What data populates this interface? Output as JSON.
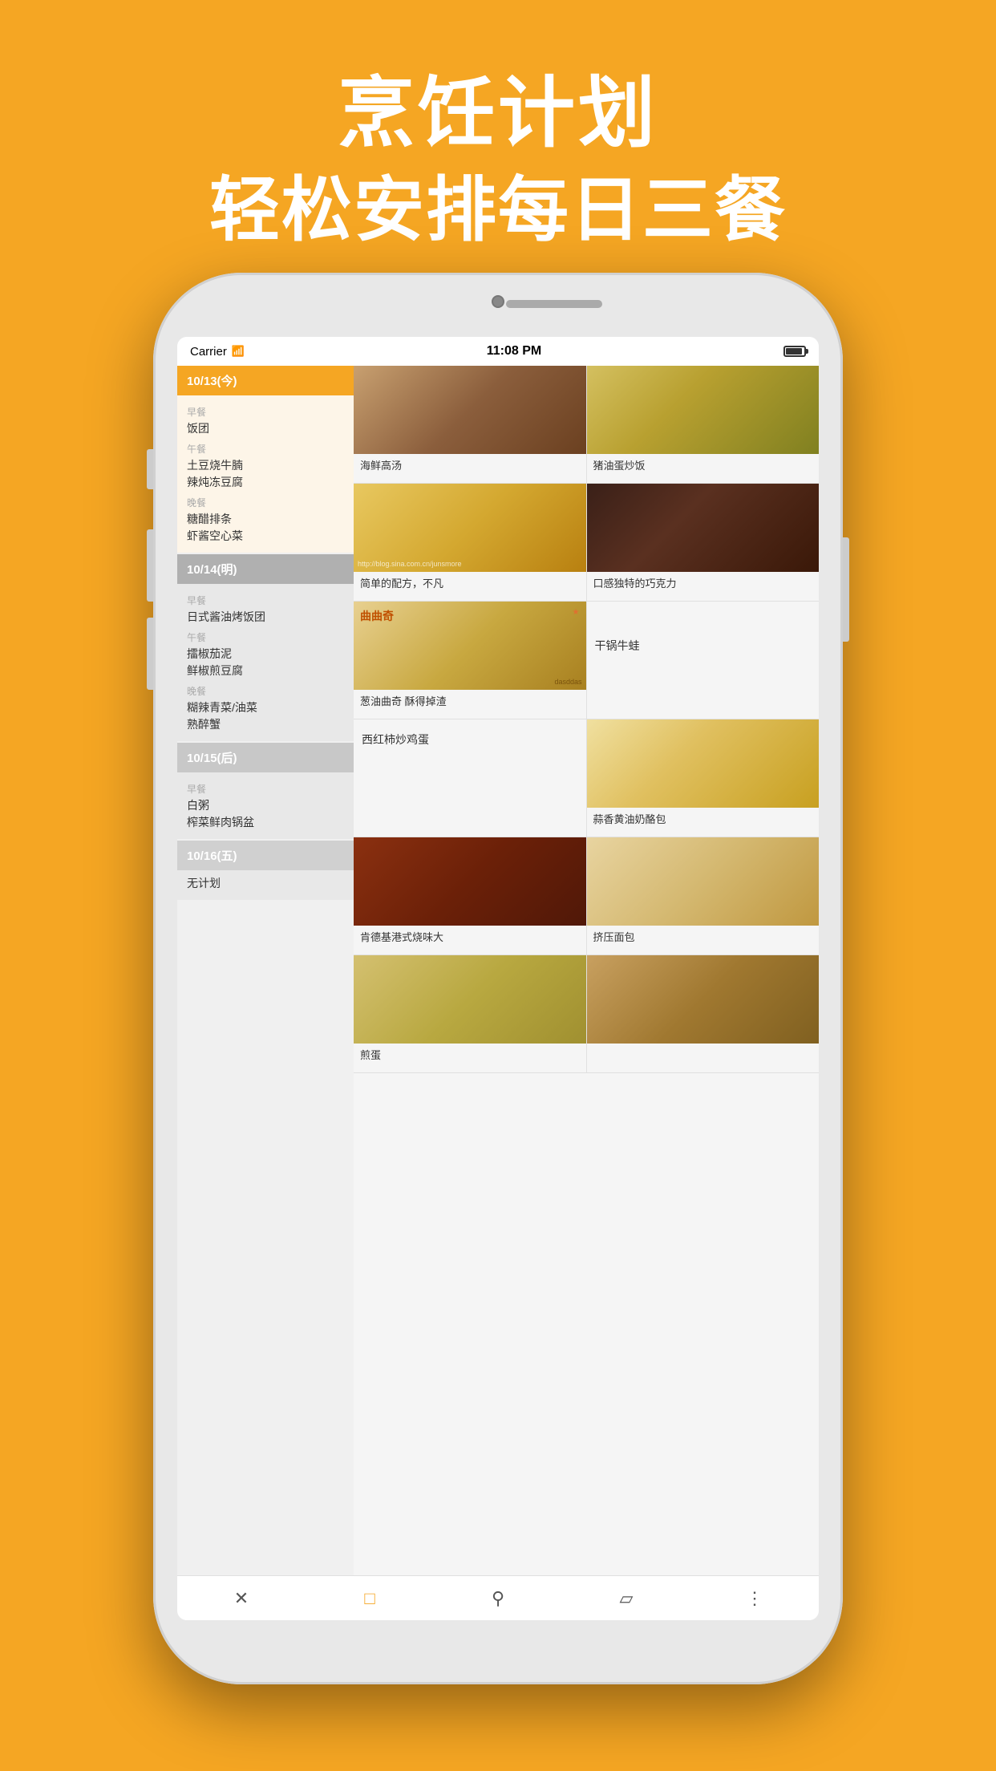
{
  "header": {
    "line1": "烹饪计划",
    "line2": "轻松安排每日三餐"
  },
  "status_bar": {
    "carrier": "Carrier",
    "wifi": "WiFi",
    "time": "11:08 PM",
    "battery": "full"
  },
  "left_panel": {
    "days": [
      {
        "id": "today",
        "header": "10/13(今)",
        "type": "today",
        "meals": [
          {
            "type": "早餐",
            "items": [
              "饭团"
            ]
          },
          {
            "type": "午餐",
            "items": [
              "土豆烧牛腩",
              "辣炖冻豆腐"
            ]
          },
          {
            "type": "晚餐",
            "items": [
              "糖醋排条",
              "虾酱空心菜"
            ]
          }
        ]
      },
      {
        "id": "tomorrow",
        "header": "10/14(明)",
        "type": "tomorrow",
        "meals": [
          {
            "type": "早餐",
            "items": [
              "日式酱油烤饭团"
            ]
          },
          {
            "type": "午餐",
            "items": [
              "擂椒茄泥",
              "鲜椒煎豆腐"
            ]
          },
          {
            "type": "晚餐",
            "items": [
              "糊辣青菜/油菜",
              "熟醉蟹"
            ]
          }
        ]
      },
      {
        "id": "day-after",
        "header": "10/15(后)",
        "type": "day-after",
        "meals": [
          {
            "type": "早餐",
            "items": [
              "白粥",
              "榨菜鲜肉锅盆"
            ]
          }
        ]
      },
      {
        "id": "friday",
        "header": "10/16(五)",
        "type": "friday",
        "meals": [
          {
            "type": "",
            "items": [
              "无计划"
            ]
          }
        ]
      }
    ]
  },
  "right_panel": {
    "recipes": [
      {
        "id": "r1",
        "image": true,
        "image_type": "top-partial",
        "label": "海鲜高汤",
        "has_image": true
      },
      {
        "id": "r2",
        "image": true,
        "image_type": "top-partial",
        "label": "猪油蛋炒饭",
        "has_image": true
      },
      {
        "id": "r3",
        "image": true,
        "label": "简单的配方，不凡",
        "has_image": true,
        "watermark": "http://blog.sina.com.cn/junsmore"
      },
      {
        "id": "r4",
        "image": true,
        "label": "口感独特的巧克力",
        "has_image": true
      },
      {
        "id": "r5",
        "image": true,
        "label": "葱油曲奇 酥得掉渣",
        "has_image": true,
        "overlay": "曲曲奇"
      },
      {
        "id": "r6",
        "image": false,
        "label": "干锅牛蛙",
        "has_image": false
      },
      {
        "id": "r7",
        "image": false,
        "label": "西红柿炒鸡蛋",
        "has_image": false
      },
      {
        "id": "r8",
        "image": true,
        "label": "蒜香黄油奶酪包",
        "has_image": true
      },
      {
        "id": "r9",
        "image": true,
        "label": "肯德基港式烧味大",
        "has_image": true
      },
      {
        "id": "r10",
        "image": true,
        "label": "挤压面包",
        "has_image": true
      },
      {
        "id": "r11",
        "image": true,
        "label": "煎蛋",
        "has_image": false
      },
      {
        "id": "r12",
        "image": true,
        "label": "",
        "has_image": true
      }
    ]
  },
  "tab_bar": {
    "items": [
      {
        "id": "close",
        "icon": "✕",
        "label": "关闭"
      },
      {
        "id": "calendar",
        "icon": "📅",
        "label": "日历",
        "active": true
      },
      {
        "id": "search",
        "icon": "🔍",
        "label": "搜索"
      },
      {
        "id": "tag",
        "icon": "🏷",
        "label": "标签"
      },
      {
        "id": "more",
        "icon": "⋮",
        "label": "更多"
      }
    ]
  }
}
